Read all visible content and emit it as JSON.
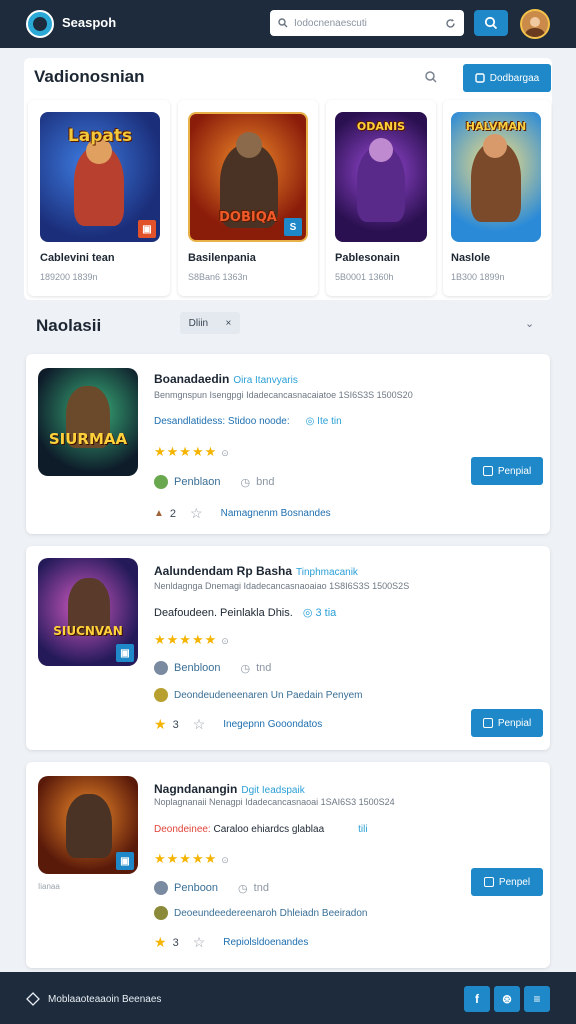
{
  "header": {
    "app_name": "Seaspoh",
    "search_placeholder": "Iodocnenaescuti",
    "search_button_icon": "search-icon",
    "avatar": "user-avatar"
  },
  "featured": {
    "title": "Vadionosnian",
    "filter_label": "Dodbargaa",
    "cards": [
      {
        "cover_text": "Lapats",
        "name": "Cablevini tean",
        "meta": "189200 1839n"
      },
      {
        "cover_text": "DOBIQA",
        "name": "Basilenpania",
        "meta": "S8Ban6 1363n"
      },
      {
        "cover_text": "ODANIS",
        "name": "Pablesonain",
        "meta": "5B0001 1360h"
      },
      {
        "cover_text": "HALVMAN",
        "name": "Naslole",
        "meta": "1B300 1899n"
      }
    ]
  },
  "recommended": {
    "title": "Naolasii",
    "filter_label": "Dliin",
    "filter_close": "×",
    "chevron": "⌄",
    "items": [
      {
        "thumb_text": "SIURMAA",
        "title": "Boanadaedin",
        "title_sub": "Oira Itanvyaris",
        "line": "Benmgnspun Isengpgi Idadecancasnacaiatoe 1SI6S3S 1500S20",
        "link": "Desandlatidess: Stidoo noode:",
        "link_extra": "Ite tin",
        "stars": "★★★★★",
        "rating_circle": "⊙",
        "meta_a": "Penblaon",
        "meta_b": "bnd",
        "count": "2",
        "tag": "Namagnenm Bosnandes",
        "install_label": "Penpial"
      },
      {
        "thumb_text": "SIUCNVAN",
        "title": "Aalundendam Rp Basha",
        "title_sub": "Tinphmacanik",
        "line": "Nenldagnga Dnemagi Idadecancasnaoaiao 1S8I6S3S 1500S2S",
        "link": "Deafoudeen. Peinlakla Dhis.",
        "link_extra": "3 tia",
        "stars": "★★★★★",
        "rating_circle": "⊙",
        "meta_a": "Benbloon",
        "meta_b": "tnd",
        "count": "3",
        "tag": "Inegepnn Gooondatos",
        "install_label": "Penpial",
        "extra_line": "Deondeudeneenaren Un Paedain Penyem"
      },
      {
        "thumb_text": "",
        "title": "Nagndanangin",
        "title_sub": "Dgit Ieadspaik",
        "line": "Noplagnanaii Nenagpi Idadecancasnaoai 1SAI6S3 1500S24",
        "link_red": "Deondeinee:",
        "link": "Caraloo ehiardcs glablaa",
        "link_extra": "tili",
        "stars": "★★★★★",
        "rating_circle": "⊙",
        "meta_a": "Penboon",
        "meta_b": "tnd",
        "count": "3",
        "tag": "Repiolsldoenandes",
        "install_label": "Penpel",
        "extra_line": "Deoeundeedereenaroh Dhleiadn Beeiradon",
        "under_thumb": "Iianaa"
      }
    ]
  },
  "footer": {
    "copyright": "Moblaaoteaaoin Beenaes",
    "social": [
      "f",
      "⊛",
      "≡"
    ]
  }
}
